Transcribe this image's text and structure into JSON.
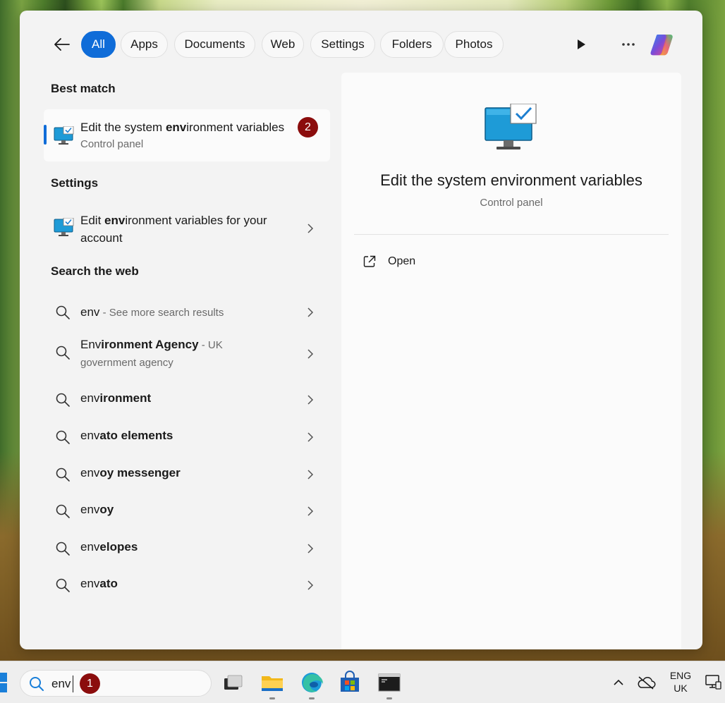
{
  "filters": {
    "back_label": "Back",
    "items": [
      {
        "label": "All",
        "active": true
      },
      {
        "label": "Apps"
      },
      {
        "label": "Documents"
      },
      {
        "label": "Web"
      },
      {
        "label": "Settings"
      },
      {
        "label": "Folders"
      },
      {
        "label": "Photos"
      }
    ]
  },
  "best_match": {
    "heading": "Best match",
    "title_pre": "Edit the system ",
    "title_bold": "env",
    "title_post": "ironment variables",
    "subtitle": "Control panel",
    "badge": "2"
  },
  "settings": {
    "heading": "Settings",
    "item_pre": "Edit ",
    "item_bold": "env",
    "item_post": "ironment variables for your",
    "item_line2": "account"
  },
  "web": {
    "heading": "Search the web",
    "items": [
      {
        "bold": "",
        "plain": "env",
        "suffix": " - See more search results"
      },
      {
        "pre": "Env",
        "bold": "ironment Agency",
        "suffix": " - UK",
        "line2": "government agency"
      },
      {
        "pre": "env",
        "bold": "ironment"
      },
      {
        "pre": "env",
        "bold": "ato elements"
      },
      {
        "pre": "env",
        "bold": "oy messenger"
      },
      {
        "pre": "env",
        "bold": "oy"
      },
      {
        "pre": "env",
        "bold": "elopes"
      },
      {
        "pre": "env",
        "bold": "ato"
      }
    ]
  },
  "detail": {
    "title": "Edit the system environment variables",
    "subtitle": "Control panel",
    "action_open": "Open"
  },
  "taskbar": {
    "search_text": "env",
    "search_badge": "1",
    "lang_line1": "ENG",
    "lang_line2": "UK"
  },
  "colors": {
    "accent": "#0f6cd8",
    "badge": "#8b0d0d",
    "panel_bg": "#f3f3f3"
  }
}
